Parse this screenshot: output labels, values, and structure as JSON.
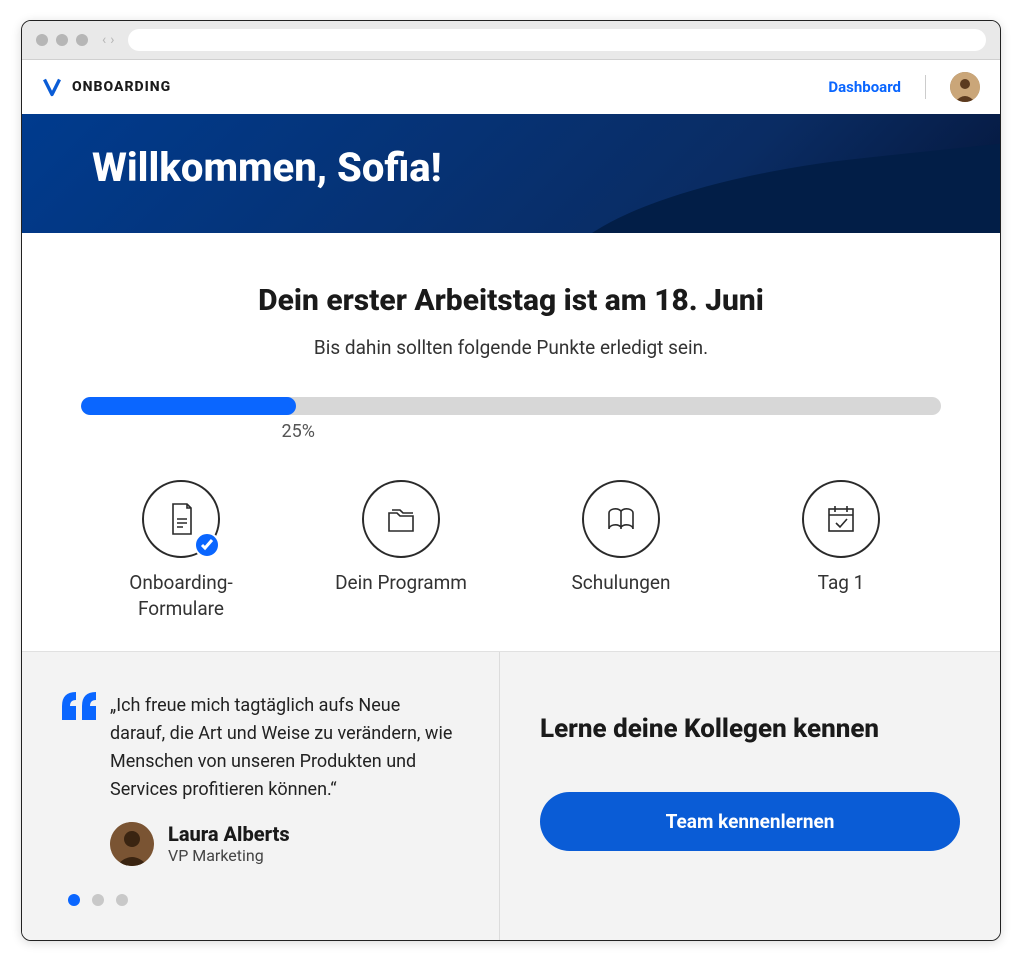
{
  "topbar": {
    "app_title": "ONBOARDING",
    "dashboard_label": "Dashboard"
  },
  "hero": {
    "greeting": "Willkommen, Sofia!"
  },
  "main": {
    "headline": "Dein erster Arbeitstag ist am 18. Juni",
    "subtext": "Bis dahin sollten folgende Punkte erledigt sein.",
    "progress_percent": "25%",
    "progress_value": 25
  },
  "steps": [
    {
      "label": "Onboarding-Formulare",
      "icon": "document-check-icon",
      "completed": true
    },
    {
      "label": "Dein Programm",
      "icon": "folder-icon",
      "completed": false
    },
    {
      "label": "Schulungen",
      "icon": "book-icon",
      "completed": false
    },
    {
      "label": "Tag 1",
      "icon": "calendar-check-icon",
      "completed": false
    }
  ],
  "quote": {
    "text": "„Ich freue mich tagtäglich aufs Neue darauf, die Art und Weise zu verändern, wie Menschen von unseren Produkten und Services profitieren können.“",
    "author_name": "Laura Alberts",
    "author_title": "VP Marketing"
  },
  "pager": {
    "count": 3,
    "active_index": 0
  },
  "right": {
    "heading": "Lerne deine Kollegen kennen",
    "cta_label": "Team kennenlernen"
  }
}
